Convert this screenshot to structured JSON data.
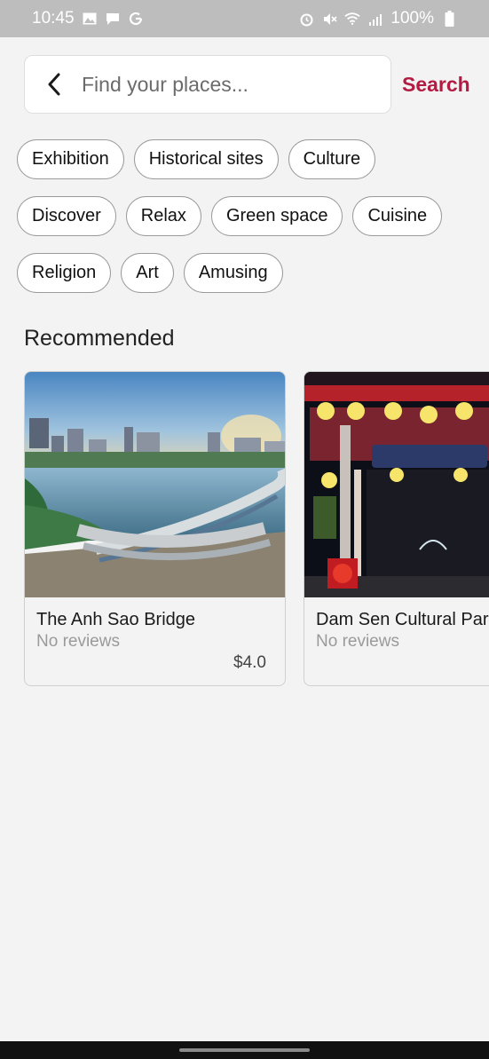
{
  "status_bar": {
    "time": "10:45",
    "battery": "100%"
  },
  "search": {
    "placeholder": "Find your places...",
    "value": "",
    "button_label": "Search"
  },
  "categories": [
    [
      "Exhibition",
      "Historical sites",
      "Culture"
    ],
    [
      "Discover",
      "Relax",
      "Green space",
      "Cuisine"
    ],
    [
      "Religion",
      "Art",
      "Amusing"
    ]
  ],
  "section_title": "Recommended",
  "places": [
    {
      "name": "The Anh Sao Bridge",
      "reviews": "No reviews",
      "price": "$4.0"
    },
    {
      "name": "Dam Sen Cultural Park",
      "reviews": "No reviews",
      "price": ""
    }
  ],
  "colors": {
    "accent": "#b31b43",
    "background": "#f3f3f3",
    "status_bar": "#bdbdbd"
  }
}
